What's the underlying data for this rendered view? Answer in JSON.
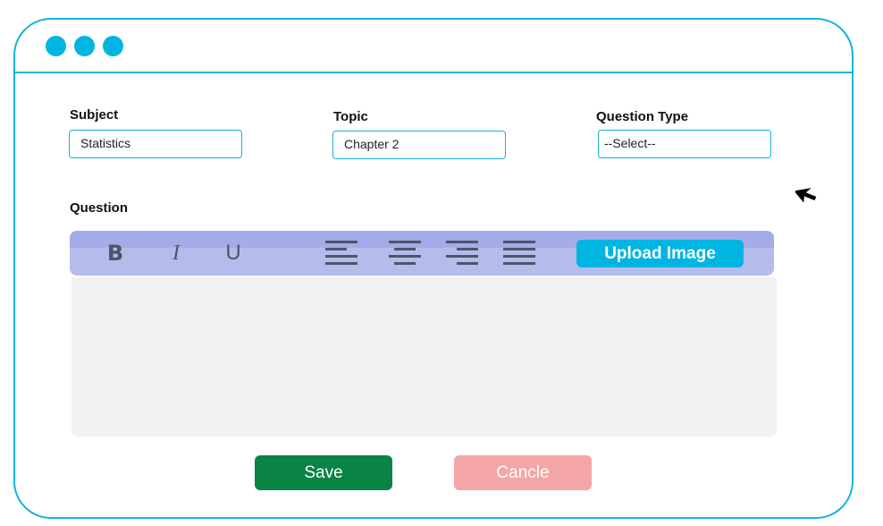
{
  "form": {
    "subject": {
      "label": "Subject",
      "value": "Statistics"
    },
    "topic": {
      "label": "Topic",
      "value": "Chapter 2"
    },
    "question_type": {
      "label": "Question Type",
      "value": "--Select--"
    },
    "question": {
      "label": "Question"
    }
  },
  "toolbar": {
    "bold": "B",
    "italic": "I",
    "underline": "U",
    "upload_label": "Upload Image",
    "icons": [
      "align-left-icon",
      "align-center-icon",
      "align-right-icon",
      "align-justify-icon"
    ]
  },
  "actions": {
    "save_label": "Save",
    "cancel_label": "Cancle"
  },
  "colors": {
    "accent": "#00b5e2",
    "toolbar_bg": "#b4bcec",
    "save": "#0a8347",
    "cancel": "#f4a6a6",
    "editor_bg": "#f1f1f1"
  }
}
